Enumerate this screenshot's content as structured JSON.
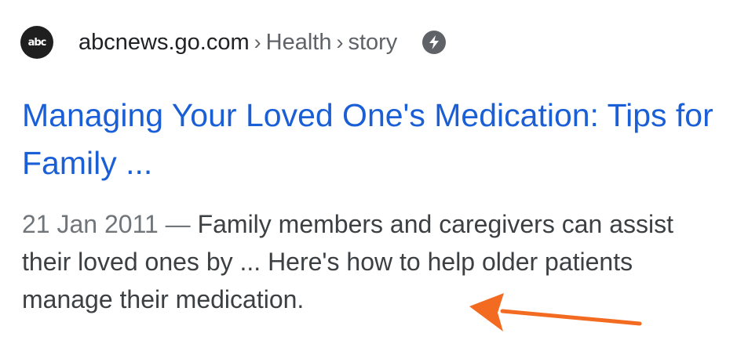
{
  "result": {
    "source": {
      "favicon_text": "abc",
      "domain": "abcnews.go.com",
      "breadcrumbs": [
        "Health",
        "story"
      ],
      "separator": "›",
      "amp_icon": "lightning-bolt-icon"
    },
    "title": "Managing Your Loved One's Medication: Tips for Family ...",
    "snippet": {
      "date": "21 Jan 2011",
      "dash": "—",
      "text": "Family members and caregivers can assist their loved ones by ... Here's how to help older patients manage their medication."
    }
  },
  "annotation": {
    "arrow_color": "#f26b21",
    "arrow_icon": "arrow-pointing-left"
  }
}
